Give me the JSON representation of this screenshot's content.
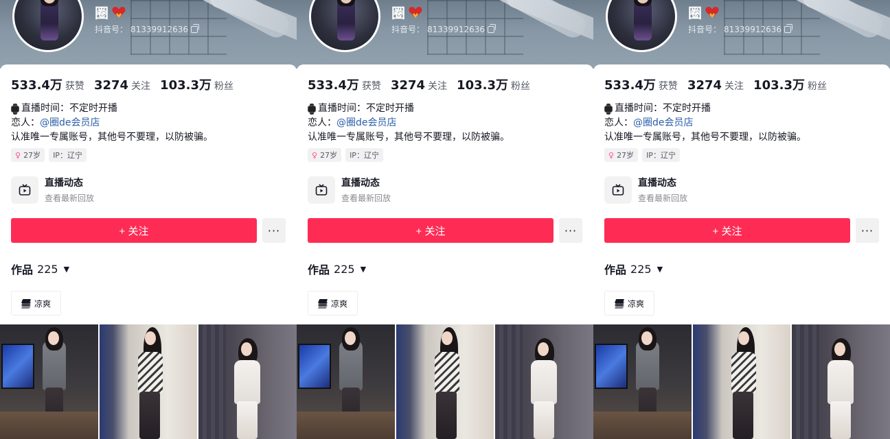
{
  "profile": {
    "name": "圈",
    "id_label": "抖音号：",
    "id_value": "81339912636",
    "stats": [
      {
        "num": "533.4万",
        "label": "获赞"
      },
      {
        "num": "3274",
        "label": "关注"
      },
      {
        "num": "103.3万",
        "label": "粉丝"
      }
    ],
    "bio": {
      "line1": "直播时间：不定时开播",
      "line2_prefix": "恋人：",
      "line2_mention": "@圈de会员店",
      "line3": "认准唯一专属账号，其他号不要理，以防被骗。"
    },
    "tags": {
      "age": "27岁",
      "ip": "IP：辽宁"
    },
    "live": {
      "title": "直播动态",
      "subtitle": "查看最新回放"
    },
    "follow_label": "+ 关注",
    "more_label": "···",
    "works_label": "作品",
    "works_count": "225",
    "caret": "▼",
    "collection_label": "凉爽"
  },
  "colors": {
    "accent": "#fe2c55",
    "mention": "#2a5ea8",
    "female": "#ff4f8b"
  },
  "icons": [
    "heart-icon",
    "copy-icon",
    "watch-icon",
    "female-icon",
    "tv-live-icon",
    "more-icon",
    "caret-down-icon",
    "layers-icon"
  ]
}
